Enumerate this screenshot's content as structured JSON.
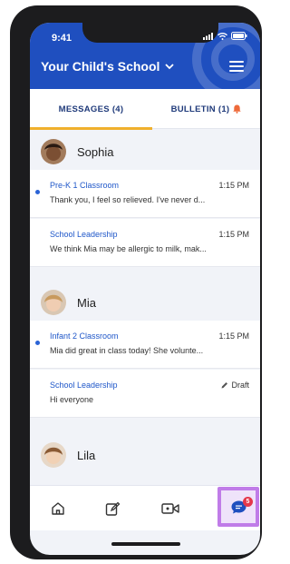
{
  "status_bar": {
    "time": "9:41"
  },
  "header": {
    "title": "Your Child's School"
  },
  "tabs": [
    {
      "label": "MESSAGES (4)",
      "active": true
    },
    {
      "label": "BULLETIN (1)",
      "active": false
    }
  ],
  "contacts": [
    {
      "name": "Sophia",
      "messages": [
        {
          "from": "Pre-K 1 Classroom",
          "time": "1:15 PM",
          "preview": "Thank you, I feel so relieved. I've never d...",
          "unread": true
        },
        {
          "from": "School Leadership",
          "time": "1:15 PM",
          "preview": "We think Mia may be allergic to milk, mak...",
          "unread": false
        }
      ]
    },
    {
      "name": "Mia",
      "messages": [
        {
          "from": "Infant 2 Classroom",
          "time": "1:15 PM",
          "preview": "Mia did great in class today! She volunte...",
          "unread": true
        },
        {
          "from": "School Leadership",
          "time": "Draft",
          "preview": "Hi everyone",
          "unread": false,
          "draft": true
        }
      ]
    },
    {
      "name": "Lila",
      "messages": []
    }
  ],
  "bottom_nav": {
    "items": [
      "home-icon",
      "compose-icon",
      "video-icon",
      "messages-icon"
    ],
    "messages_badge": "5"
  },
  "colors": {
    "header_blue": "#1f4fbf",
    "tab_underline": "#f0b02c",
    "link_blue": "#1f57c9",
    "unread_dot": "#2a63d6",
    "badge_red": "#e4374b",
    "highlight_purple": "#c07ce8"
  }
}
